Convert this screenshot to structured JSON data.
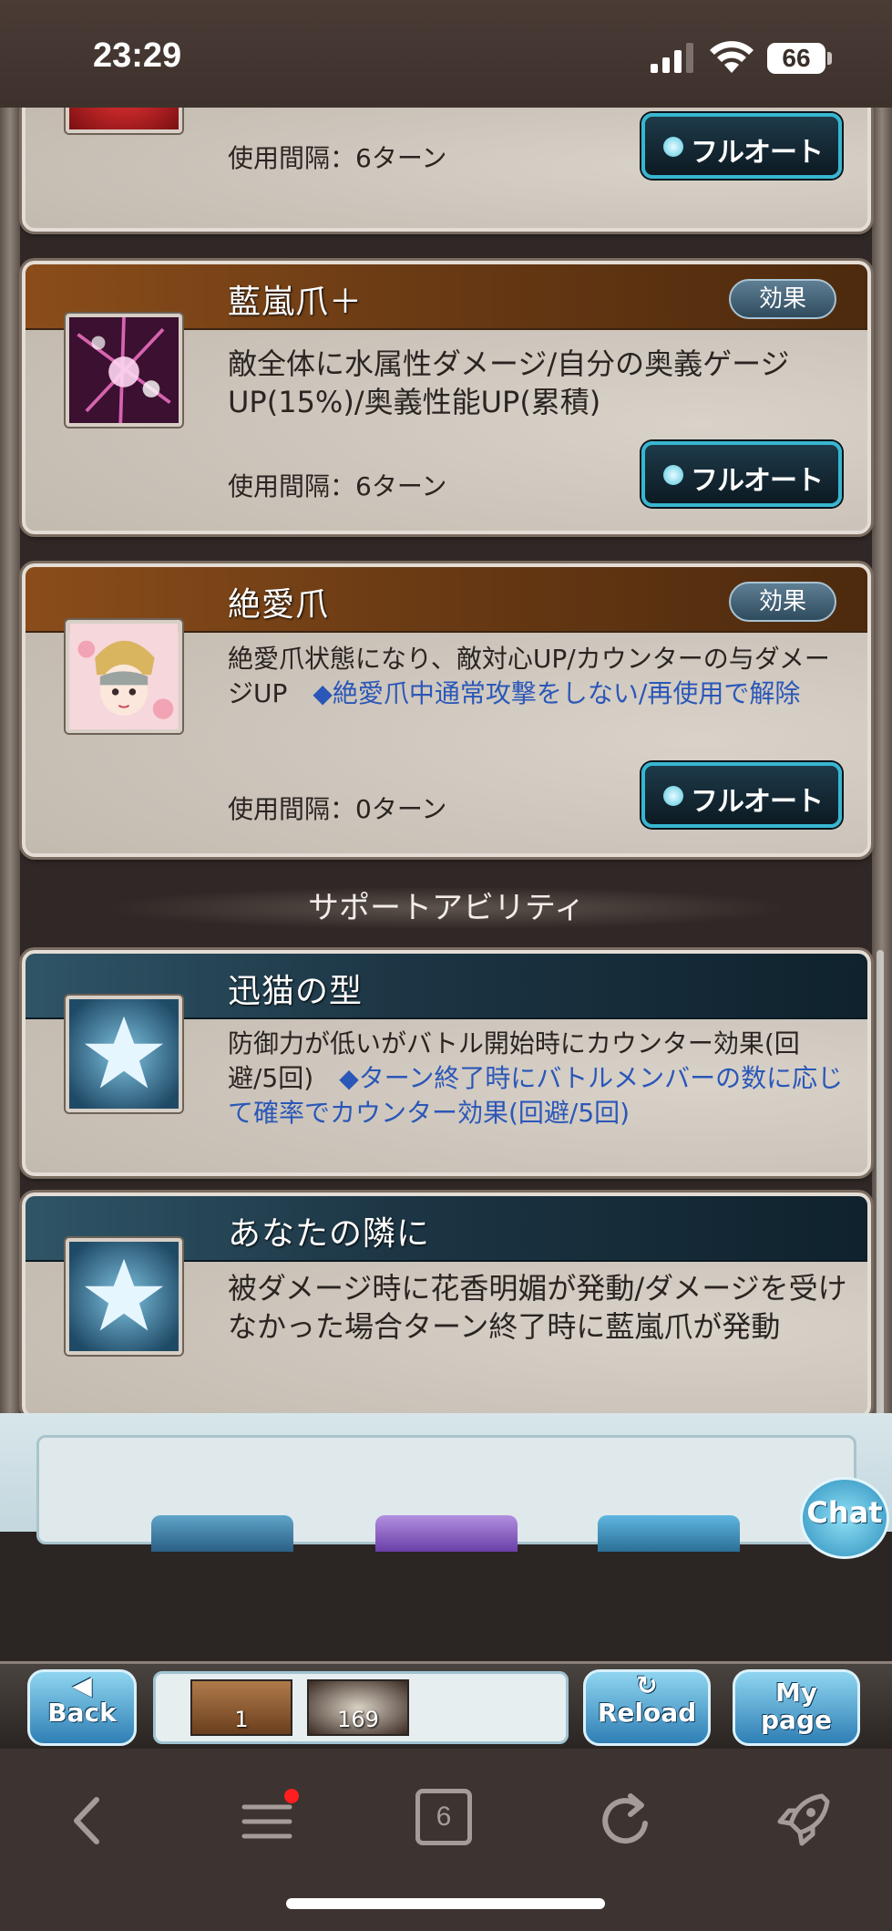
{
  "status": {
    "time": "23:29",
    "battery": "66"
  },
  "abilities": [
    {
      "title": "",
      "description": "",
      "interval": "使用間隔：6ターン",
      "button": "フルオート"
    },
    {
      "title": "藍嵐爪＋",
      "effect": "効果",
      "description": "敵全体に水属性ダメージ/自分の奥義ゲージUP(15%)/奥義性能UP(累積)",
      "interval": "使用間隔：6ターン",
      "button": "フルオート"
    },
    {
      "title": "絶愛爪",
      "effect": "効果",
      "description": "絶愛爪状態になり、敵対心UP/カウンターの与ダメージUP　",
      "note": "◆絶愛爪中通常攻撃をしない/再使用で解除",
      "interval": "使用間隔：0ターン",
      "button": "フルオート"
    }
  ],
  "support_section_title": "サポートアビリティ",
  "supports": [
    {
      "title": "迅猫の型",
      "description": "防御力が低いがバトル開始時にカウンター効果(回避/5回)　",
      "note": "◆ターン終了時にバトルメンバーの数に応じて確率でカウンター効果(回避/5回)"
    },
    {
      "title": "あなたの隣に",
      "description": "被ダメージ時に花香明媚が発動/ダメージを受けなかった場合ターン終了時に藍嵐爪が発動"
    }
  ],
  "chat_label": "Chat",
  "game_nav": {
    "back": "Back",
    "reload": "Reload",
    "mypage_line1": "My",
    "mypage_line2": "page",
    "party1_count": "1",
    "party2_count": "169"
  },
  "browser": {
    "tabs_count": "6"
  },
  "colors": {
    "card_header_brown": "#6b3b14",
    "card_header_blue": "#1c3544",
    "button_border": "#37b6d0",
    "note_blue": "#2a57b8"
  }
}
